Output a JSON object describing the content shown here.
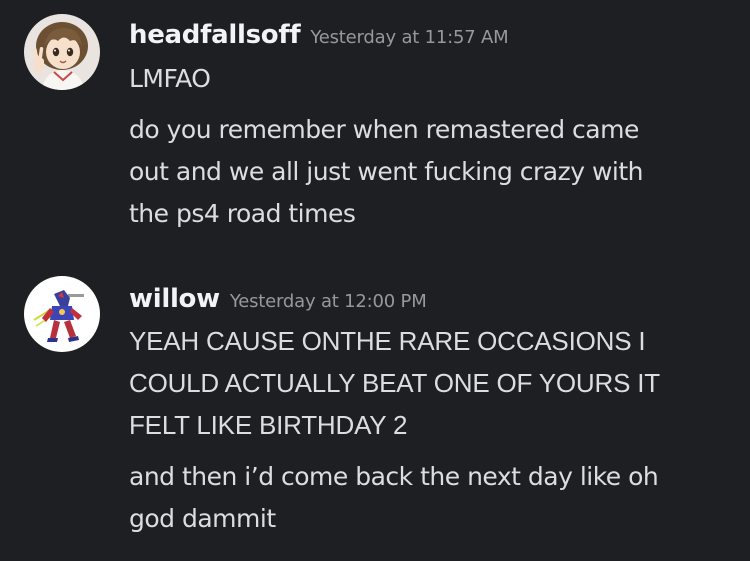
{
  "messages": [
    {
      "username": "headfallsoff",
      "timestamp": "Yesterday at 11:57 AM",
      "avatar_icon": "anime-girl-peace-sign-avatar",
      "lines": [
        "LMFAO",
        "do you remember when remastered came",
        "out and we all just went fucking crazy with",
        "the ps4 road times"
      ]
    },
    {
      "username": "willow",
      "timestamp": "Yesterday at 12:00 PM",
      "avatar_icon": "robot-mech-avatar",
      "lines": [
        "YEAH CAUSE ONTHE RARE OCCASIONS I",
        "COULD ACTUALLY BEAT ONE OF YOURS IT",
        "FELT LIKE BIRTHDAY 2",
        "and then i’d come back the next day like oh",
        "god dammit"
      ]
    }
  ],
  "colors": {
    "background": "#1e1f22",
    "username": "#f2f3f5",
    "timestamp": "#96989d",
    "message_text": "#dcdde1"
  }
}
